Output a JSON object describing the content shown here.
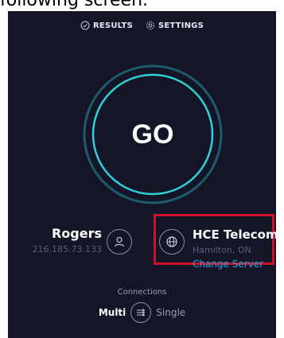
{
  "caption": "following screen.",
  "nav": {
    "results_label": "RESULTS",
    "settings_label": "SETTINGS"
  },
  "go_label": "GO",
  "isp": {
    "name": "Rogers",
    "ip": "216.185.73.133"
  },
  "server": {
    "name": "HCE Telecom",
    "location": "Hamilton, ON",
    "change_label": "Change Server"
  },
  "connections": {
    "label": "Connections",
    "multi_label": "Multi",
    "single_label": "Single"
  },
  "colors": {
    "background": "#141526",
    "ring_outer": "#1f5a6e",
    "ring_inner": "#2ed1d8",
    "link": "#2aa9e0",
    "highlight_box": "#d0102a"
  }
}
